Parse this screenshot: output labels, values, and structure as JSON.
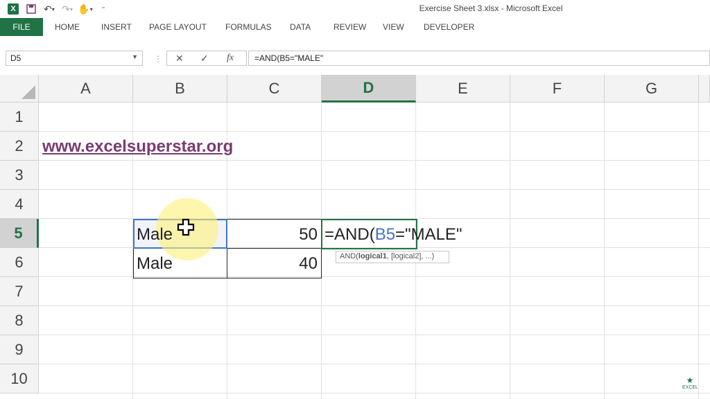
{
  "window": {
    "title": "Exercise Sheet 3.xlsx - Microsoft Excel"
  },
  "qat": {
    "icons": [
      "excel-logo",
      "save-icon",
      "undo-icon",
      "redo-icon",
      "touch-mode-icon",
      "customize-icon"
    ]
  },
  "ribbon": {
    "file": "FILE",
    "tabs": [
      "HOME",
      "INSERT",
      "PAGE LAYOUT",
      "FORMULAS",
      "DATA",
      "REVIEW",
      "VIEW",
      "DEVELOPER"
    ]
  },
  "formula_bar": {
    "name_box": "D5",
    "content": "=AND(B5=\"MALE\""
  },
  "sheet": {
    "columns": [
      "A",
      "B",
      "C",
      "D",
      "E",
      "F",
      "G"
    ],
    "rows": [
      "1",
      "2",
      "3",
      "4",
      "5",
      "6",
      "7",
      "8",
      "9",
      "10"
    ],
    "active_cell": "D5",
    "cells": {
      "a2": "www.excelsuperstar.org",
      "b5": "Male",
      "c5": "50",
      "b6": "Male",
      "c6": "40",
      "d5_prefix": "=AND(",
      "d5_ref": "B5",
      "d5_suffix": "=\"MALE\""
    },
    "tooltip": {
      "func": "AND(",
      "bold_arg": "logical1",
      "rest": ", [logical2], ...)"
    }
  },
  "watermark": "EXCEL",
  "colors": {
    "accent": "#217346",
    "link": "#7a3b72",
    "ref": "#4472c4"
  }
}
